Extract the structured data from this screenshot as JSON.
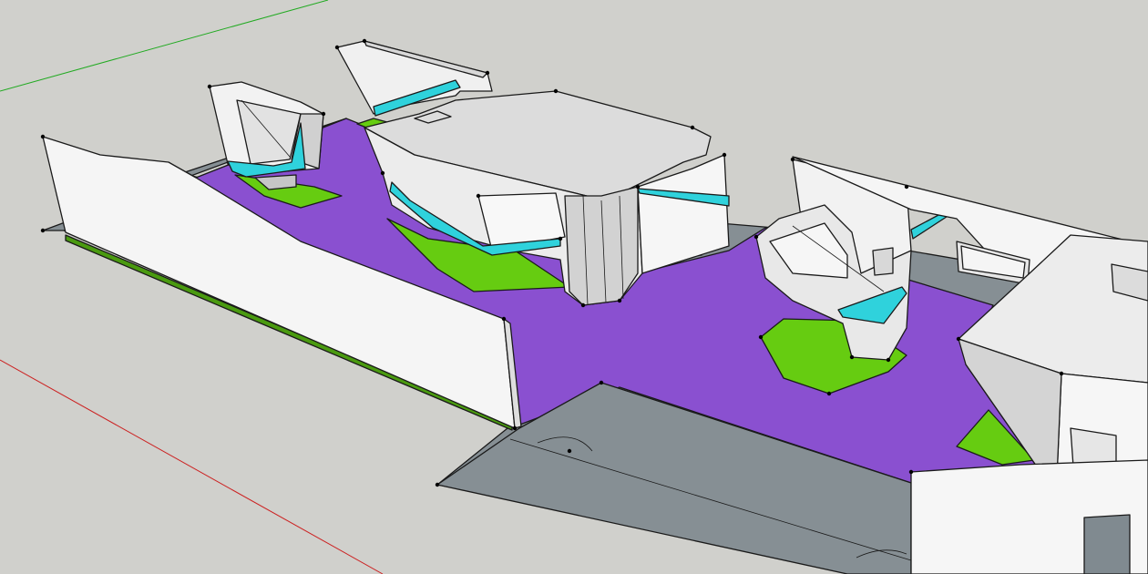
{
  "scene": {
    "type": "3d-model-viewport",
    "colors": {
      "background": "#d0d0cc",
      "floor_purple": "#8a50d0",
      "grass_green": "#66cc11",
      "ramp_gray": "#868f94",
      "wall_white": "#f5f5f5",
      "wall_shade": "#d6d6d6",
      "accent_cyan": "#2fd2dc",
      "axis_red": "#cc2222",
      "axis_green": "#22aa22"
    }
  }
}
